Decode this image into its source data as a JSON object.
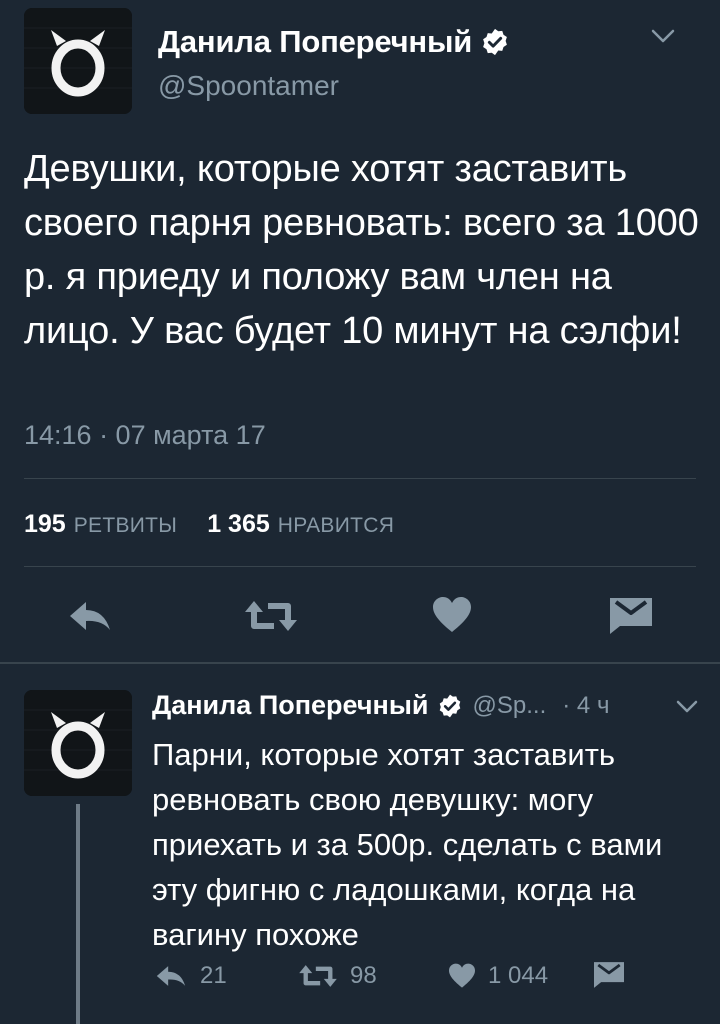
{
  "colors": {
    "background": "#1c2733",
    "text": "#ffffff",
    "secondary": "#8899a6",
    "divider": "#38444d",
    "icon": "#8899a6"
  },
  "main_tweet": {
    "name": "Данила Поперечный",
    "handle": "@Spoontamer",
    "text": "Девушки, которые хотят заставить своего парня ревновать: всего за 1000 р. я приеду и положу вам член на лицо. У вас будет 10 минут на сэлфи!",
    "timestamp": "14:16 · 07 марта 17",
    "retweets_count": "195",
    "retweets_label": "РЕТВИТЫ",
    "likes_count": "1 365",
    "likes_label": "НРАВИТСЯ",
    "icons": [
      "reply-icon",
      "retweet-icon",
      "like-icon",
      "dm-icon",
      "verified-icon",
      "chevron-down-icon"
    ]
  },
  "reply_tweet": {
    "name": "Данила Поперечный",
    "handle": "@Sp...",
    "time": "· 4 ч",
    "text": "Парни, которые хотят заставить ревновать свою девушку: могу приехать и за 500р. сделать с вами эту фигню с ладошками, когда на вагину похоже",
    "reply_count": "21",
    "retweet_count": "98",
    "like_count": "1 044"
  }
}
